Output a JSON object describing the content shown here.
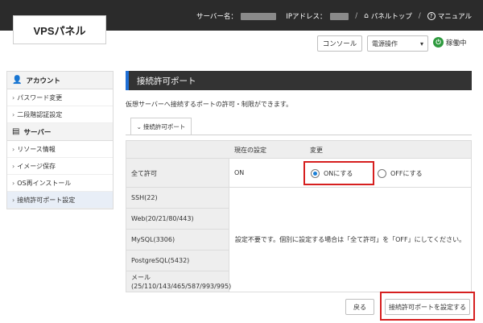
{
  "header": {
    "logo": "VPSパネル",
    "server_name_label": "サーバー名：",
    "ip_label": "IPアドレス：",
    "panel_top": "パネルトップ",
    "manual": "マニュアル"
  },
  "controls": {
    "console": "コンソール",
    "power_select": "電源操作",
    "status": "稼働中"
  },
  "sidebar": {
    "account_heading": "アカウント",
    "account_items": [
      "パスワード変更",
      "二段階認証設定"
    ],
    "server_heading": "サーバー",
    "server_items": [
      "リソース情報",
      "イメージ保存",
      "OS再インストール",
      "接続許可ポート設定"
    ]
  },
  "main": {
    "title": "接続許可ポート",
    "description": "仮想サーバーへ接続するポートの許可・制限ができます。",
    "tab": "接続許可ポート",
    "table": {
      "col_current": "現在の設定",
      "col_change": "変更",
      "all_allow_label": "全て許可",
      "all_allow_value": "ON",
      "radio_on": "ONにする",
      "radio_off": "OFFにする",
      "services": [
        "SSH(22)",
        "Web(20/21/80/443)",
        "MySQL(3306)",
        "PostgreSQL(5432)"
      ],
      "mail_label": "メール",
      "mail_ports": "(25/110/143/465/587/993/995)",
      "note": "設定不要です。個別に設定する場合は「全て許可」を「OFF」にしてください。"
    },
    "back_button": "戻る",
    "apply_button": "接続許可ポートを設定する"
  }
}
